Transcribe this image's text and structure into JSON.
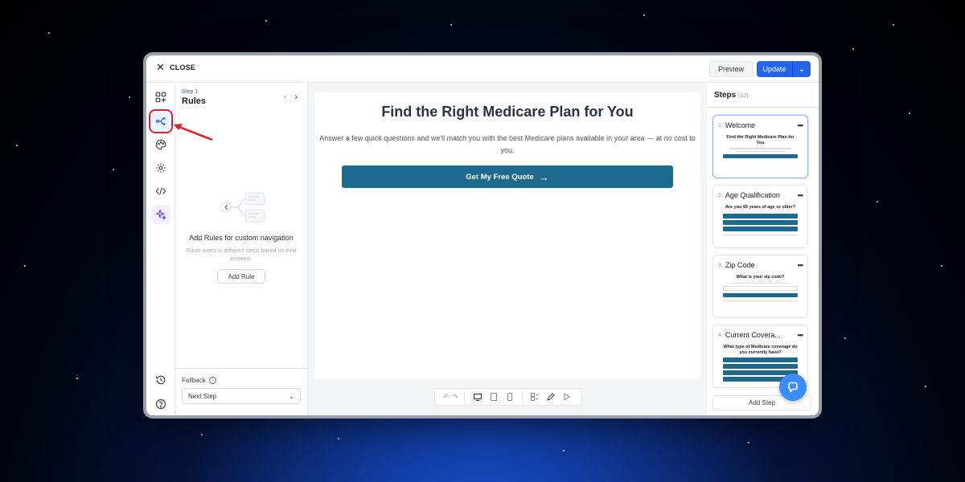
{
  "topbar": {
    "close_label": "CLOSE",
    "preview_label": "Preview",
    "update_label": "Update"
  },
  "icon_rail": {
    "items": [
      {
        "icon": "grid-plus-icon"
      },
      {
        "icon": "branch-icon",
        "active": true
      },
      {
        "icon": "palette-icon"
      },
      {
        "icon": "gear-icon"
      },
      {
        "icon": "code-icon"
      },
      {
        "icon": "sparkle-icon"
      }
    ],
    "bottom": [
      {
        "icon": "history-icon"
      },
      {
        "icon": "help-icon"
      }
    ]
  },
  "rules_panel": {
    "step_label": "Step 1",
    "title": "Rules",
    "empty_title": "Add Rules for custom navigation",
    "empty_desc": "Route users to different steps based on their answers.",
    "add_rule_label": "Add Rule",
    "fallback_label": "Fallback",
    "fallback_value": "Next Step"
  },
  "canvas": {
    "headline": "Find the Right Medicare Plan for You",
    "subline": "Answer a few quick questions and we'll match you with the best Medicare plans available in your area — at no cost to you.",
    "cta_label": "Get My Free Quote",
    "cta_arrow": "→"
  },
  "toolbar": {
    "undo": "↶",
    "redo": "↷"
  },
  "steps_panel": {
    "title": "Steps",
    "count": "(12)",
    "add_step_label": "Add Step",
    "items": [
      {
        "num": "1.",
        "name": "Welcome",
        "thumb_title": "Find the Right Medicare Plan for You",
        "selected": true
      },
      {
        "num": "2.",
        "name": "Age Qualification",
        "thumb_title": "Are you 65 years of age or older?"
      },
      {
        "num": "3.",
        "name": "Zip Code",
        "thumb_title": "What is your zip code?"
      },
      {
        "num": "4.",
        "name": "Current Covera...",
        "thumb_title": "What type of Medicare coverage do you currently have?"
      }
    ]
  },
  "colors": {
    "accent": "#2563eb",
    "cta": "#1e6a8f",
    "annotation": "#e11d2b",
    "chat_fab": "#3b8cff"
  }
}
